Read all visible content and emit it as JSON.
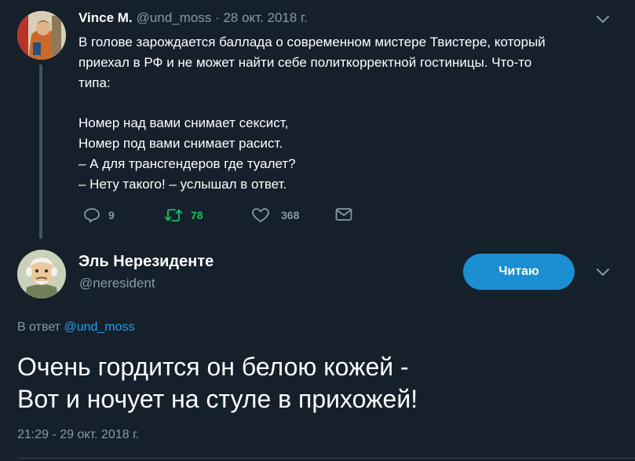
{
  "parent_tweet": {
    "author_name": "Vince M.",
    "meta": "@und_moss · 28 окт. 2018 г.",
    "lines": [
      "В голове зарождается баллада о современном мистере Твистере, который",
      "приехал в РФ и не может найти себе политкорректной гостиницы. Что-то",
      "типа:",
      "",
      "Номер над вами снимает сексист,",
      "Номер под вами снимает расист.",
      "– А для трансгендеров где туалет?",
      "– Нету такого! – услышал в ответ."
    ],
    "replies": "9",
    "retweets": "78",
    "likes": "368",
    "icons": [
      "reply-icon",
      "retweet-icon",
      "like-icon",
      "direct-message-icon",
      "chevron-down-icon"
    ]
  },
  "main_tweet": {
    "author_name": "Эль Нерезиденте",
    "handle": "@neresident",
    "follow_label": "Читаю",
    "reply_prefix": "В ответ",
    "reply_mention": "@und_moss",
    "lines": [
      "Очень гордится он белою кожей -",
      "Вот и ночует на стуле в прихожей!"
    ],
    "timestamp": "21:29 - 29 окт. 2018 г."
  },
  "colors": {
    "background": "#15202b",
    "secondary_text": "#8899a6",
    "accent": "#1da1f2",
    "retweet_active": "#17bf63",
    "follow_button": "#1b8fd1"
  }
}
